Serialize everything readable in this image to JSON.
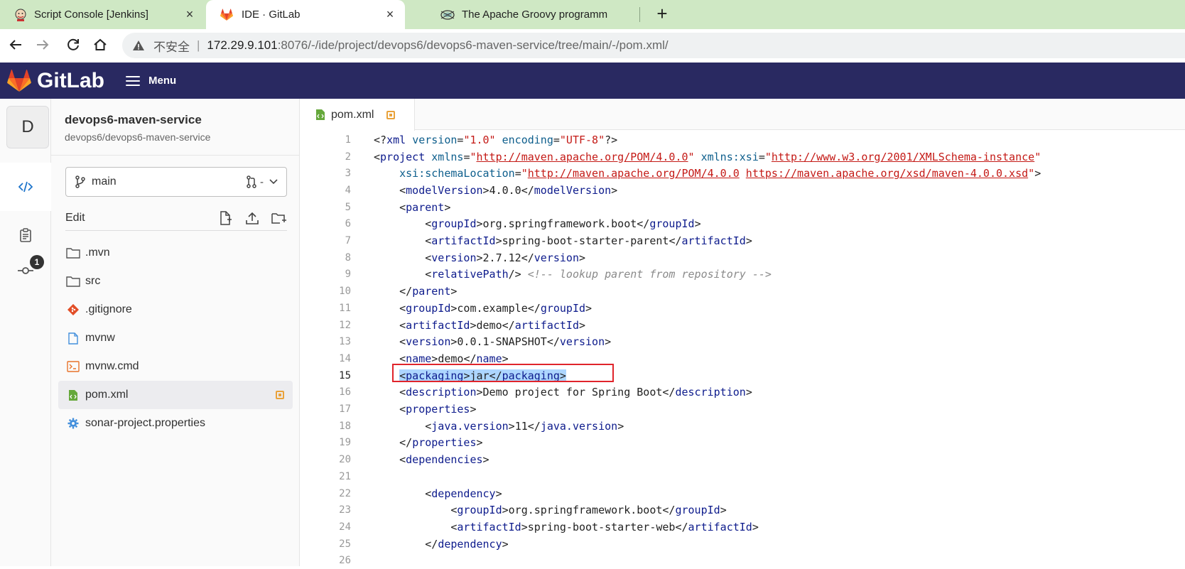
{
  "browser": {
    "tabs": [
      {
        "title": "Script Console [Jenkins]",
        "active": false
      },
      {
        "title": "IDE · GitLab",
        "active": true
      },
      {
        "title": "The Apache Groovy programm",
        "active": false
      }
    ],
    "address": {
      "security_label": "不安全",
      "host": "172.29.9.101",
      "path": ":8076/-/ide/project/devops6/devops6-maven-service/tree/main/-/pom.xml/"
    }
  },
  "header": {
    "brand": "GitLab",
    "menu_label": "Menu",
    "colors": {
      "background": "#292961",
      "brand_orange": "#e24329"
    }
  },
  "activity": {
    "avatar_letter": "D",
    "commit_badge": "1"
  },
  "project": {
    "name": "devops6-maven-service",
    "path": "devops6/devops6-maven-service",
    "branch": "main",
    "mr_label": "-",
    "edit_label": "Edit"
  },
  "files": [
    {
      "name": ".mvn",
      "icon": "folder-icon"
    },
    {
      "name": "src",
      "icon": "folder-icon"
    },
    {
      "name": ".gitignore",
      "icon": "git-icon"
    },
    {
      "name": "mvnw",
      "icon": "file-icon"
    },
    {
      "name": "mvnw.cmd",
      "icon": "terminal-icon"
    },
    {
      "name": "pom.xml",
      "icon": "xml-icon",
      "selected": true,
      "changed": true
    },
    {
      "name": "sonar-project.properties",
      "icon": "gear-icon"
    }
  ],
  "editor": {
    "tab_name": "pom.xml",
    "current_line": 15
  },
  "code_lines": [
    "<?xml version=\"1.0\" encoding=\"UTF-8\"?>",
    "<project xmlns=\"http://maven.apache.org/POM/4.0.0\" xmlns:xsi=\"http://www.w3.org/2001/XMLSchema-instance\"",
    "    xsi:schemaLocation=\"http://maven.apache.org/POM/4.0.0 https://maven.apache.org/xsd/maven-4.0.0.xsd\">",
    "    <modelVersion>4.0.0</modelVersion>",
    "    <parent>",
    "        <groupId>org.springframework.boot</groupId>",
    "        <artifactId>spring-boot-starter-parent</artifactId>",
    "        <version>2.7.12</version>",
    "        <relativePath/> <!-- lookup parent from repository -->",
    "    </parent>",
    "    <groupId>com.example</groupId>",
    "    <artifactId>demo</artifactId>",
    "    <version>0.0.1-SNAPSHOT</version>",
    "    <name>demo</name>",
    "    <packaging>jar</packaging>",
    "    <description>Demo project for Spring Boot</description>",
    "    <properties>",
    "        <java.version>11</java.version>",
    "    </properties>",
    "    <dependencies>",
    "",
    "        <dependency>",
    "            <groupId>org.springframework.boot</groupId>",
    "            <artifactId>spring-boot-starter-web</artifactId>",
    "        </dependency>",
    ""
  ]
}
